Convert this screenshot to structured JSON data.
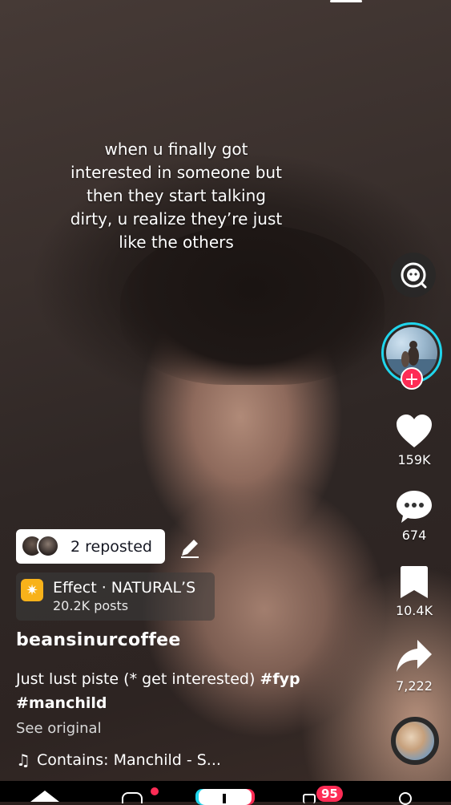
{
  "overlay_text": "when u finally got\ninterested in someone but\nthen they start talking\ndirty, u realize they’re just\nlike the others",
  "actions": {
    "likes": "159K",
    "comments": "674",
    "saves": "10.4K",
    "shares": "7,222"
  },
  "repost": {
    "label": "2 reposted"
  },
  "effect": {
    "title": "Effect · NATURAL’S",
    "posts": "20.2K posts"
  },
  "post": {
    "username": "beansinurcoffee",
    "caption_text": "Just lust piste (* get interested) ",
    "hashtags": [
      "#fyp",
      "#manchild"
    ],
    "see_original": "See original",
    "music": "Contains: Manchild - S..."
  },
  "nav": {
    "inbox_badge": "95"
  },
  "colors": {
    "accent_red": "#fe2c55",
    "accent_cyan": "#20d5ec",
    "effect_yellow": "#f8b21a"
  },
  "icons": [
    "search-lens-icon",
    "plus-icon",
    "heart-icon",
    "comment-icon",
    "bookmark-icon",
    "share-icon",
    "pencil-icon",
    "effect-sparkle-icon",
    "music-note-icon",
    "home-icon",
    "shop-icon",
    "create-icon",
    "inbox-icon",
    "profile-icon"
  ]
}
